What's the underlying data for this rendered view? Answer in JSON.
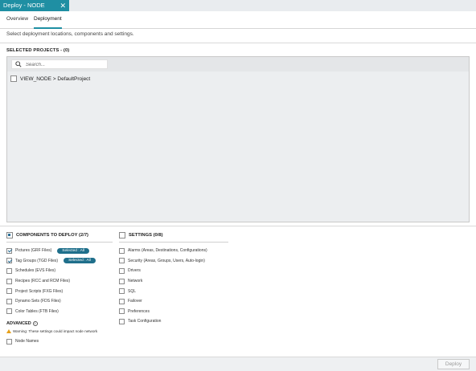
{
  "window": {
    "tab_title": "Deploy - NODE",
    "close_glyph": "✕"
  },
  "subtabs": [
    {
      "label": "Overview",
      "active": false
    },
    {
      "label": "Deployment",
      "active": true
    }
  ],
  "description": "Select deployment locations, components and settings.",
  "projects": {
    "title": "SELECTED PROJECTS - (0)",
    "search_placeholder": "Search...",
    "items": [
      {
        "label": "VIEW_NODE > DefaultProject",
        "checked": false
      }
    ]
  },
  "components": {
    "title": "COMPONENTS TO DEPLOY (2/7)",
    "items": [
      {
        "label": "Pictures (GRF Files)",
        "checked": true,
        "pill": "Selected : All"
      },
      {
        "label": "Tag Groups (TGD Files)",
        "checked": true,
        "pill": "Selected : All"
      },
      {
        "label": "Schedules (EVS Files)",
        "checked": false
      },
      {
        "label": "Recipes (RCC and RCM Files)",
        "checked": false
      },
      {
        "label": "Project Scripts (FXG Files)",
        "checked": false
      },
      {
        "label": "Dynamo Sets (FDS Files)",
        "checked": false
      },
      {
        "label": "Color Tables (FTB Files)",
        "checked": false
      }
    ]
  },
  "settings": {
    "title": "SETTINGS (0/8)",
    "items": [
      {
        "label": "Alarms (Areas, Destinations, Configurations)",
        "checked": false
      },
      {
        "label": "Security (Areas, Groups, Users, Auto-login)",
        "checked": false
      },
      {
        "label": "Drivers",
        "checked": false
      },
      {
        "label": "Network",
        "checked": false
      },
      {
        "label": "SQL",
        "checked": false
      },
      {
        "label": "Failover",
        "checked": false
      },
      {
        "label": "Preferences",
        "checked": false
      },
      {
        "label": "Task Configuration",
        "checked": false
      }
    ]
  },
  "advanced": {
    "title": "ADVANCED",
    "warning": "Warning: These settings could impact node network",
    "items": [
      {
        "label": "Node Names",
        "checked": false
      }
    ]
  },
  "footer": {
    "deploy_label": "Deploy"
  },
  "colors": {
    "accent": "#1f8fa3",
    "pill": "#1f6f8b",
    "warning": "#e6a019"
  }
}
